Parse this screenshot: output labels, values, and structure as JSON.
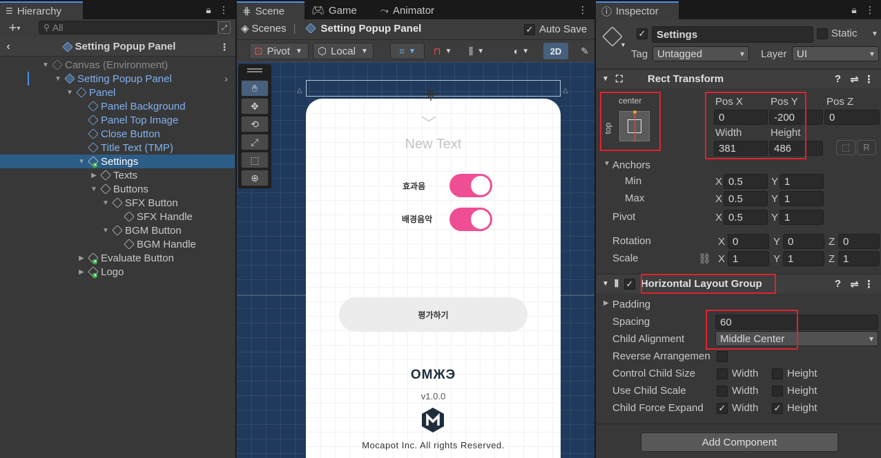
{
  "hierarchy": {
    "tab_label": "Hierarchy",
    "search_placeholder": "All",
    "prefab_title": "Setting Popup Panel",
    "items": [
      {
        "label": "Canvas (Environment)"
      },
      {
        "label": "Setting Popup Panel"
      },
      {
        "label": "Panel"
      },
      {
        "label": "Panel Background"
      },
      {
        "label": "Panel Top Image"
      },
      {
        "label": "Close Button"
      },
      {
        "label": "Title Text (TMP)"
      },
      {
        "label": "Settings"
      },
      {
        "label": "Texts"
      },
      {
        "label": "Buttons"
      },
      {
        "label": "SFX Button"
      },
      {
        "label": "SFX Handle"
      },
      {
        "label": "BGM Button"
      },
      {
        "label": "BGM Handle"
      },
      {
        "label": "Evaluate Button"
      },
      {
        "label": "Logo"
      }
    ]
  },
  "scene": {
    "tabs": [
      {
        "label": "Scene"
      },
      {
        "label": "Game"
      },
      {
        "label": "Animator"
      }
    ],
    "breadcrumb_root": "Scenes",
    "breadcrumb_current": "Setting Popup Panel",
    "auto_save_label": "Auto Save",
    "pivot_label": "Pivot",
    "local_label": "Local",
    "mode_2d": "2D",
    "preview": {
      "title": "New Text",
      "sfx_label": "효과음",
      "bgm_label": "배경음악",
      "evaluate_label": "평가하기",
      "logo_text": "OMЖЭ",
      "version": "v1.0.0",
      "copyright": "Mocapot Inc. All rights Reserved."
    }
  },
  "inspector": {
    "tab_label": "Inspector",
    "object_name": "Settings",
    "static_label": "Static",
    "tag_label": "Tag",
    "tag_value": "Untagged",
    "layer_label": "Layer",
    "layer_value": "UI",
    "rect_transform": {
      "title": "Rect Transform",
      "anchor_h": "center",
      "anchor_v": "top",
      "pos_x_label": "Pos X",
      "pos_x": "0",
      "pos_y_label": "Pos Y",
      "pos_y": "-200",
      "pos_z_label": "Pos Z",
      "pos_z": "0",
      "width_label": "Width",
      "width": "381",
      "height_label": "Height",
      "height": "486",
      "anchors_label": "Anchors",
      "min_label": "Min",
      "min_x": "0.5",
      "min_y": "1",
      "max_label": "Max",
      "max_x": "0.5",
      "max_y": "1",
      "pivot_label": "Pivot",
      "pivot_x": "0.5",
      "pivot_y": "1",
      "rotation_label": "Rotation",
      "rot_x": "0",
      "rot_y": "0",
      "rot_z": "0",
      "scale_label": "Scale",
      "scale_x": "1",
      "scale_y": "1",
      "scale_z": "1",
      "x": "X",
      "y": "Y",
      "z": "Z",
      "r": "R"
    },
    "hlg": {
      "title": "Horizontal Layout Group",
      "padding_label": "Padding",
      "spacing_label": "Spacing",
      "spacing_value": "60",
      "child_alignment_label": "Child Alignment",
      "child_alignment_value": "Middle Center",
      "reverse_label": "Reverse Arrangemen",
      "control_size_label": "Control Child Size",
      "use_scale_label": "Use Child Scale",
      "force_expand_label": "Child Force Expand",
      "width": "Width",
      "height": "Height"
    },
    "add_component": "Add Component"
  }
}
